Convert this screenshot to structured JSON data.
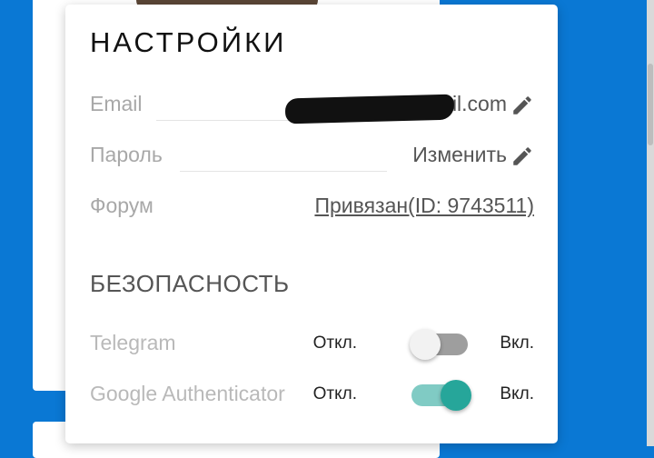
{
  "settings": {
    "title": "НАСТРОЙКИ",
    "email": {
      "label": "Email",
      "value_visible_suffix": "il.com"
    },
    "password": {
      "label": "Пароль",
      "action": "Изменить"
    },
    "forum": {
      "label": "Форум",
      "value": "Привязан(ID: 9743511)"
    }
  },
  "security": {
    "title": "БЕЗОПАСНОСТЬ",
    "items": [
      {
        "label": "Telegram",
        "off_label": "Откл.",
        "on_label": "Вкл.",
        "enabled": false
      },
      {
        "label": "Google Authenticator",
        "off_label": "Откл.",
        "on_label": "Вкл.",
        "enabled": true
      }
    ]
  },
  "icons": {
    "edit": "pencil-icon"
  },
  "colors": {
    "background_blue": "#0a78d4",
    "switch_on_track": "#80cbc4",
    "switch_on_knob": "#26a69a",
    "switch_off_track": "#9e9e9e",
    "switch_off_knob": "#f2f2f2"
  }
}
